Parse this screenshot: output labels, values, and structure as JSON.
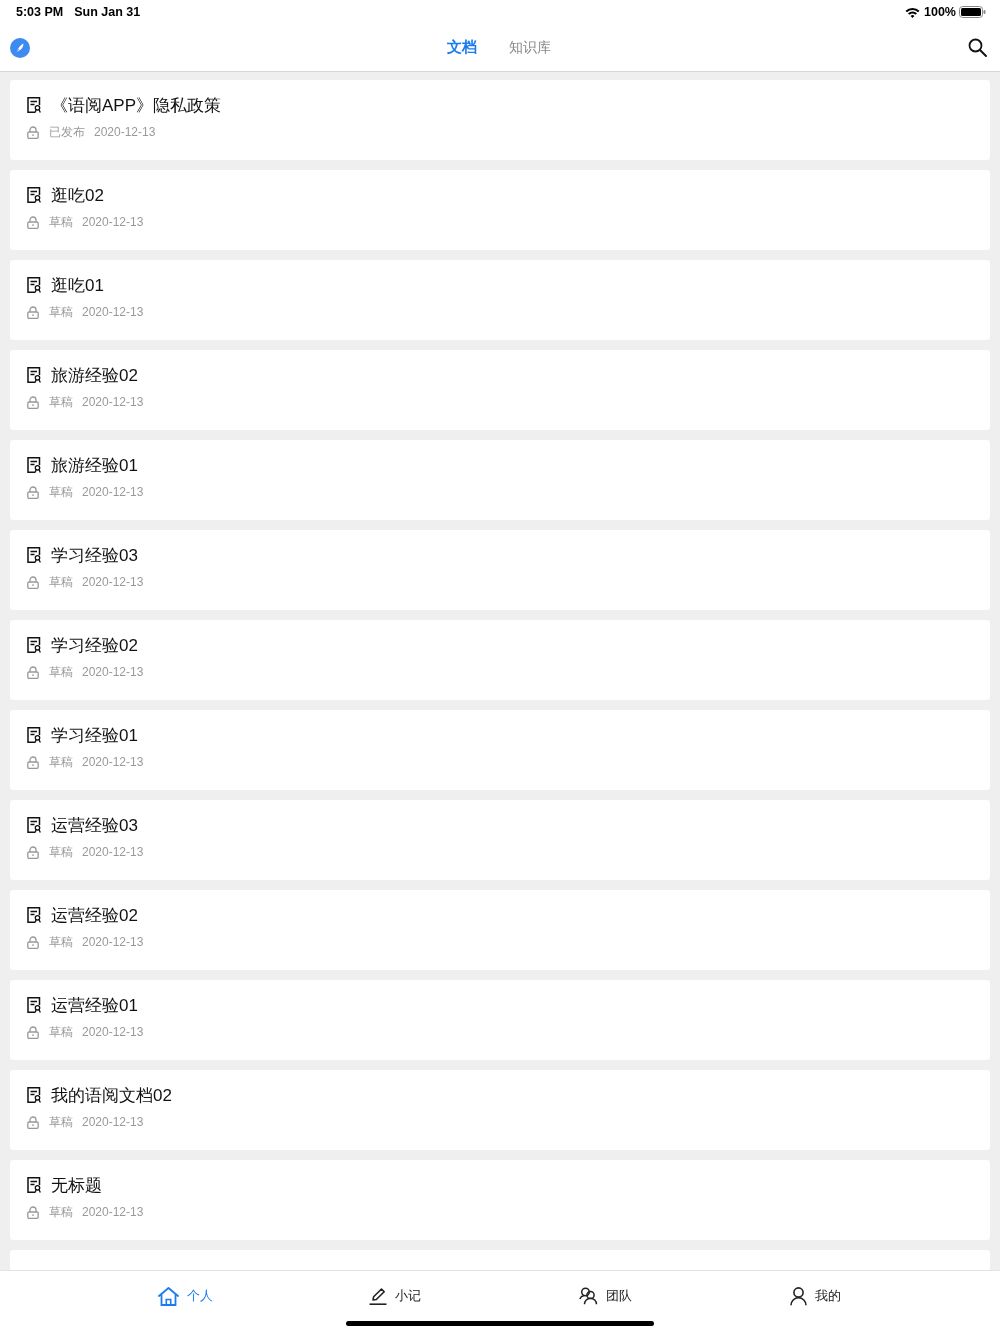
{
  "status_bar": {
    "time": "5:03 PM",
    "date": "Sun Jan 31",
    "battery": "100%"
  },
  "nav": {
    "tabs": [
      {
        "label": "文档",
        "selected": true
      },
      {
        "label": "知识库",
        "selected": false
      }
    ]
  },
  "documents": [
    {
      "title": "《语阅APP》隐私政策",
      "status": "已发布",
      "date": "2020-12-13"
    },
    {
      "title": "逛吃02",
      "status": "草稿",
      "date": "2020-12-13"
    },
    {
      "title": "逛吃01",
      "status": "草稿",
      "date": "2020-12-13"
    },
    {
      "title": "旅游经验02",
      "status": "草稿",
      "date": "2020-12-13"
    },
    {
      "title": "旅游经验01",
      "status": "草稿",
      "date": "2020-12-13"
    },
    {
      "title": "学习经验03",
      "status": "草稿",
      "date": "2020-12-13"
    },
    {
      "title": "学习经验02",
      "status": "草稿",
      "date": "2020-12-13"
    },
    {
      "title": "学习经验01",
      "status": "草稿",
      "date": "2020-12-13"
    },
    {
      "title": "运营经验03",
      "status": "草稿",
      "date": "2020-12-13"
    },
    {
      "title": "运营经验02",
      "status": "草稿",
      "date": "2020-12-13"
    },
    {
      "title": "运营经验01",
      "status": "草稿",
      "date": "2020-12-13"
    },
    {
      "title": "我的语阅文档02",
      "status": "草稿",
      "date": "2020-12-13"
    },
    {
      "title": "无标题",
      "status": "草稿",
      "date": "2020-12-13"
    }
  ],
  "tab_bar": {
    "items": [
      {
        "kind": "home",
        "label": "个人",
        "selected": true
      },
      {
        "kind": "pen",
        "label": "小记",
        "selected": false
      },
      {
        "kind": "team",
        "label": "团队",
        "selected": false
      },
      {
        "kind": "person",
        "label": "我的",
        "selected": false
      }
    ]
  }
}
